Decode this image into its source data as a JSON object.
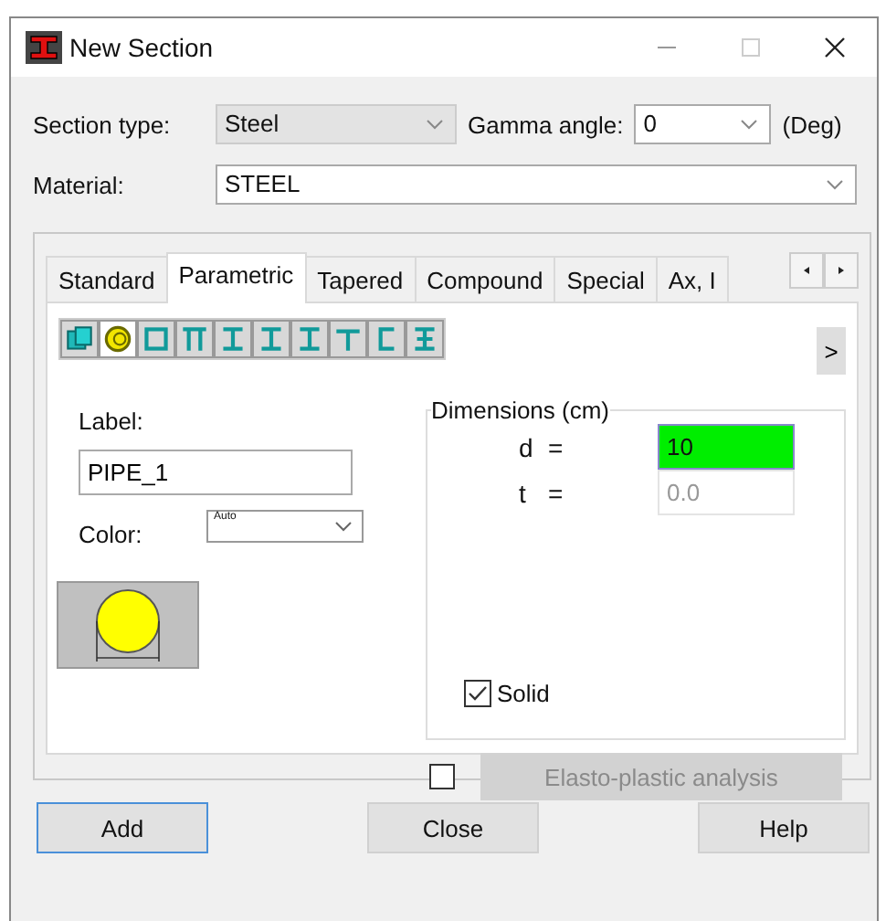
{
  "window": {
    "title": "New Section"
  },
  "section_type": {
    "label": "Section type:",
    "value": "Steel"
  },
  "gamma_angle": {
    "label": "Gamma angle:",
    "value": "0",
    "unit": "(Deg)"
  },
  "material": {
    "label": "Material:",
    "value": "STEEL"
  },
  "tabs": [
    {
      "label": "Standard",
      "selected": false
    },
    {
      "label": "Parametric",
      "selected": true
    },
    {
      "label": "Tapered",
      "selected": false
    },
    {
      "label": "Compound",
      "selected": false
    },
    {
      "label": "Special",
      "selected": false
    },
    {
      "label": "Ax, I",
      "selected": false
    }
  ],
  "shape_tools": [
    {
      "kind": "composite",
      "selected": false
    },
    {
      "kind": "pipe",
      "selected": true
    },
    {
      "kind": "box",
      "selected": false
    },
    {
      "kind": "pi",
      "selected": false
    },
    {
      "kind": "ibeam",
      "selected": false
    },
    {
      "kind": "ibeam",
      "selected": false
    },
    {
      "kind": "ibeam",
      "selected": false
    },
    {
      "kind": "tee",
      "selected": false
    },
    {
      "kind": "channel",
      "selected": false
    },
    {
      "kind": "cross",
      "selected": false
    }
  ],
  "more_button": ">",
  "label_field": {
    "label": "Label:",
    "value": "PIPE_1"
  },
  "color": {
    "label": "Color:",
    "value": "Auto"
  },
  "dimensions": {
    "title": "Dimensions (cm)",
    "fields": [
      {
        "label": "d",
        "sign": "=",
        "value": "10",
        "focused": true,
        "disabled": false
      },
      {
        "label": "t",
        "sign": "=",
        "value": "0.0",
        "focused": false,
        "disabled": true
      }
    ]
  },
  "solid": {
    "label": "Solid",
    "checked": true
  },
  "elasto_plastic": {
    "checked": false,
    "label": "Elasto-plastic analysis",
    "disabled": true
  },
  "buttons": [
    {
      "label": "Add",
      "default": true
    },
    {
      "label": "Close",
      "default": false
    },
    {
      "label": "Help",
      "default": false
    }
  ]
}
